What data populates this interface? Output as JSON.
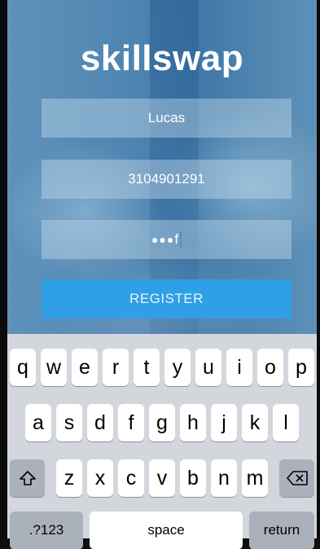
{
  "app": {
    "logo": "skillswap",
    "name_value": "Lucas",
    "phone_value": "3104901291",
    "password_masked": "●●●",
    "password_last_char": "f",
    "register_label": "REGISTER"
  },
  "keyboard": {
    "row1": [
      "q",
      "w",
      "e",
      "r",
      "t",
      "y",
      "u",
      "i",
      "o",
      "p"
    ],
    "row2": [
      "a",
      "s",
      "d",
      "f",
      "g",
      "h",
      "j",
      "k",
      "l"
    ],
    "row3": [
      "z",
      "x",
      "c",
      "v",
      "b",
      "n",
      "m"
    ],
    "numbers_label": ".?123",
    "space_label": "space",
    "return_label": "return",
    "shift_icon": "shift-icon",
    "backspace_icon": "backspace-icon"
  },
  "colors": {
    "brand_button": "#2f9fe6",
    "keyboard_bg": "#d3d7dd"
  }
}
